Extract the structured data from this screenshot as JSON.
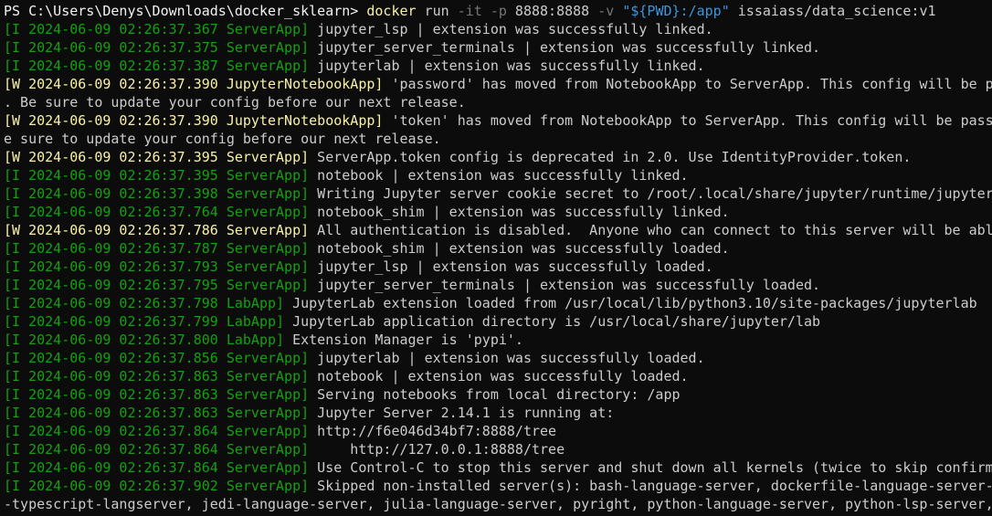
{
  "prompt": {
    "ps": "PS C:\\Users\\Denys\\Downloads\\docker_sklearn> ",
    "cmd": "docker",
    "run": " run ",
    "it": "-it",
    "p": " -p ",
    "ports": "8888:8888",
    "v": " -v ",
    "vol": "\"${PWD}:/app\"",
    "image": " issaiass/data_science:v1"
  },
  "lines": [
    {
      "tag": "[I 2024-06-09 02:26:37.367 ServerApp]",
      "text": " jupyter_lsp | extension was successfully linked."
    },
    {
      "tag": "[I 2024-06-09 02:26:37.375 ServerApp]",
      "text": " jupyter_server_terminals | extension was successfully linked."
    },
    {
      "tag": "[I 2024-06-09 02:26:37.387 ServerApp]",
      "text": " jupyterlab | extension was successfully linked."
    },
    {
      "tag": "[W 2024-06-09 02:26:37.390 JupyterNotebookApp]",
      "text": " 'password' has moved from NotebookApp to ServerApp. This config will be pa"
    },
    {
      "tag": "",
      "text": ". Be sure to update your config before our next release."
    },
    {
      "tag": "[W 2024-06-09 02:26:37.390 JupyterNotebookApp]",
      "text": " 'token' has moved from NotebookApp to ServerApp. This config will be passe"
    },
    {
      "tag": "",
      "text": "e sure to update your config before our next release."
    },
    {
      "tag": "[W 2024-06-09 02:26:37.395 ServerApp]",
      "text": " ServerApp.token config is deprecated in 2.0. Use IdentityProvider.token."
    },
    {
      "tag": "[I 2024-06-09 02:26:37.395 ServerApp]",
      "text": " notebook | extension was successfully linked."
    },
    {
      "tag": "[I 2024-06-09 02:26:37.398 ServerApp]",
      "text": " Writing Jupyter server cookie secret to /root/.local/share/jupyter/runtime/jupyter_"
    },
    {
      "tag": "[I 2024-06-09 02:26:37.764 ServerApp]",
      "text": " notebook_shim | extension was successfully linked."
    },
    {
      "tag": "[W 2024-06-09 02:26:37.786 ServerApp]",
      "text": " All authentication is disabled.  Anyone who can connect to this server will be able"
    },
    {
      "tag": "[I 2024-06-09 02:26:37.787 ServerApp]",
      "text": " notebook_shim | extension was successfully loaded."
    },
    {
      "tag": "[I 2024-06-09 02:26:37.793 ServerApp]",
      "text": " jupyter_lsp | extension was successfully loaded."
    },
    {
      "tag": "[I 2024-06-09 02:26:37.795 ServerApp]",
      "text": " jupyter_server_terminals | extension was successfully loaded."
    },
    {
      "tag": "[I 2024-06-09 02:26:37.798 LabApp]",
      "text": " JupyterLab extension loaded from /usr/local/lib/python3.10/site-packages/jupyterlab"
    },
    {
      "tag": "[I 2024-06-09 02:26:37.799 LabApp]",
      "text": " JupyterLab application directory is /usr/local/share/jupyter/lab"
    },
    {
      "tag": "[I 2024-06-09 02:26:37.800 LabApp]",
      "text": " Extension Manager is 'pypi'."
    },
    {
      "tag": "[I 2024-06-09 02:26:37.856 ServerApp]",
      "text": " jupyterlab | extension was successfully loaded."
    },
    {
      "tag": "[I 2024-06-09 02:26:37.863 ServerApp]",
      "text": " notebook | extension was successfully loaded."
    },
    {
      "tag": "[I 2024-06-09 02:26:37.863 ServerApp]",
      "text": " Serving notebooks from local directory: /app"
    },
    {
      "tag": "[I 2024-06-09 02:26:37.863 ServerApp]",
      "text": " Jupyter Server 2.14.1 is running at:"
    },
    {
      "tag": "[I 2024-06-09 02:26:37.864 ServerApp]",
      "text": " http://f6e046d34bf7:8888/tree"
    },
    {
      "tag": "[I 2024-06-09 02:26:37.864 ServerApp]",
      "text": "     http://127.0.0.1:8888/tree"
    },
    {
      "tag": "[I 2024-06-09 02:26:37.864 ServerApp]",
      "text": " Use Control-C to stop this server and shut down all kernels (twice to skip confirma"
    },
    {
      "tag": "[I 2024-06-09 02:26:37.902 ServerApp]",
      "text": " Skipped non-installed server(s): bash-language-server, dockerfile-language-server-n"
    },
    {
      "tag": "",
      "text": "-typescript-langserver, jedi-language-server, julia-language-server, pyright, python-language-server, python-lsp-server, "
    }
  ],
  "colors": {
    "background": "#0c0c0c",
    "info": "#13a10e",
    "warn": "#f9f1a5",
    "text": "#cccccc",
    "string": "#3a96dd"
  }
}
